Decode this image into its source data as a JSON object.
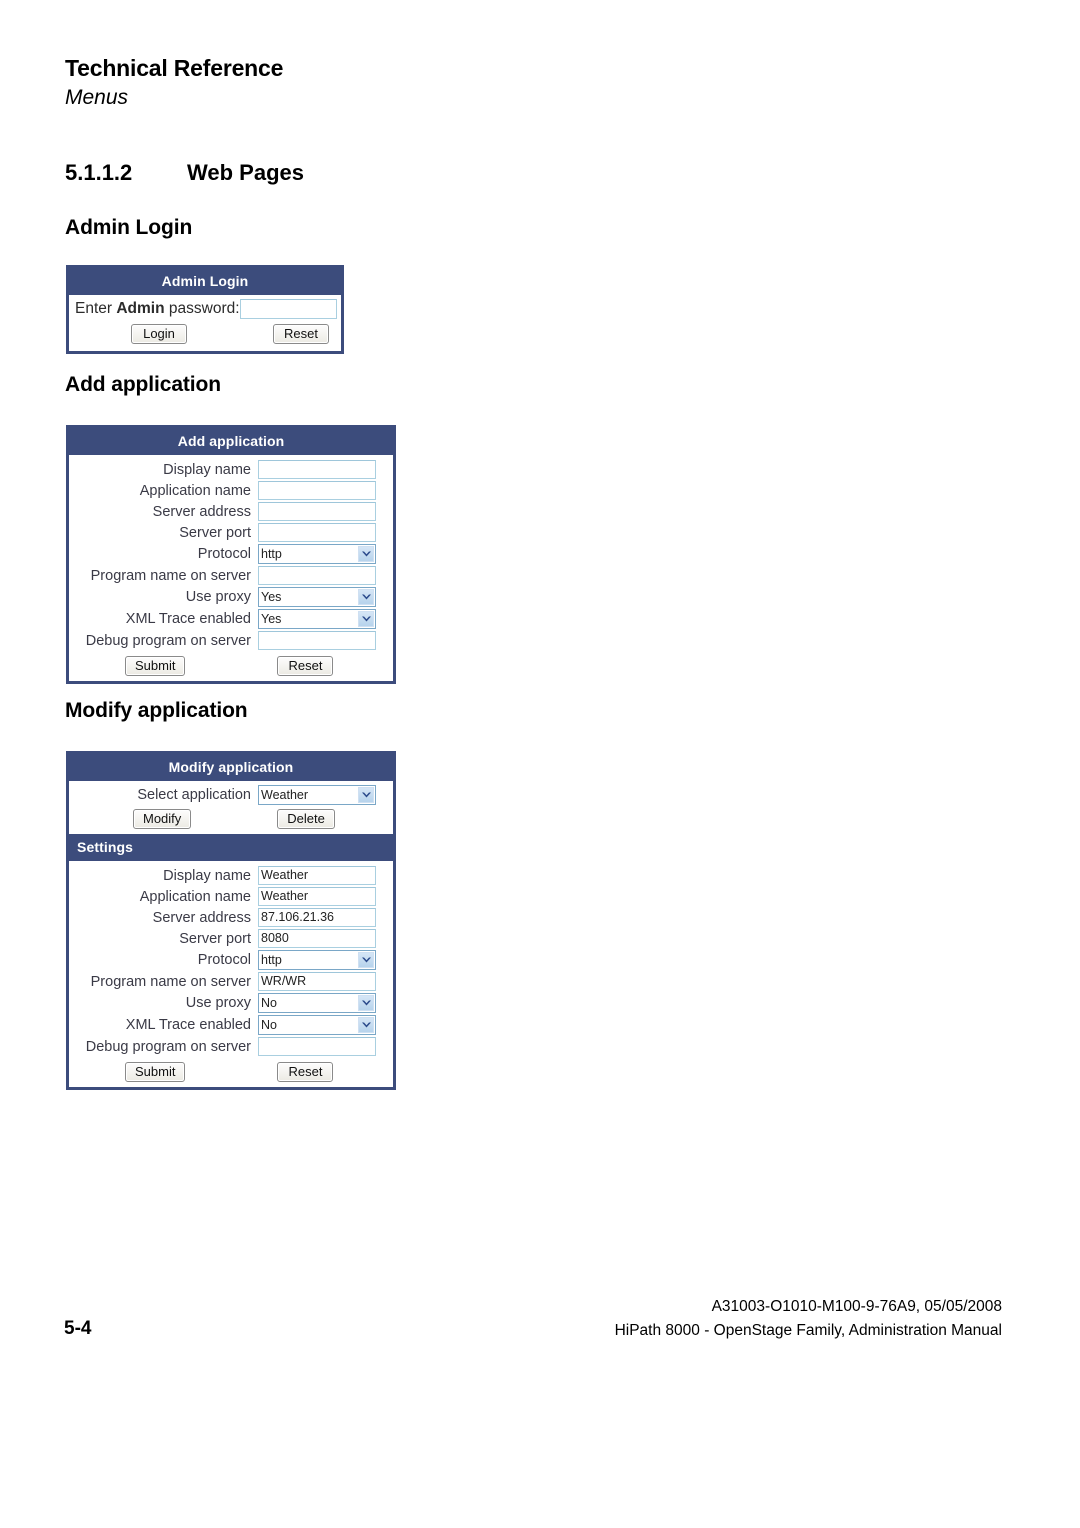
{
  "running_head": {
    "title": "Technical Reference",
    "subtitle": "Menus"
  },
  "section": {
    "number": "5.1.1.2",
    "title": "Web Pages"
  },
  "headings": {
    "admin_login": "Admin Login",
    "add_application": "Add application",
    "modify_application": "Modify application"
  },
  "admin_login_form": {
    "title": "Admin Login",
    "prompt_prefix": "Enter ",
    "prompt_bold": "Admin",
    "prompt_suffix": " password:",
    "password_value": "",
    "buttons": {
      "login": "Login",
      "reset": "Reset"
    }
  },
  "add_application_form": {
    "title": "Add application",
    "rows": [
      {
        "label": "Display name",
        "type": "text",
        "value": ""
      },
      {
        "label": "Application name",
        "type": "text",
        "value": ""
      },
      {
        "label": "Server address",
        "type": "text",
        "value": ""
      },
      {
        "label": "Server port",
        "type": "text",
        "value": ""
      },
      {
        "label": "Protocol",
        "type": "select",
        "value": "http"
      },
      {
        "label": "Program name on server",
        "type": "text",
        "value": ""
      },
      {
        "label": "Use proxy",
        "type": "select",
        "value": "Yes"
      },
      {
        "label": "XML Trace enabled",
        "type": "select",
        "value": "Yes"
      },
      {
        "label": "Debug program on server",
        "type": "text",
        "value": ""
      }
    ],
    "buttons": {
      "submit": "Submit",
      "reset": "Reset"
    }
  },
  "modify_application_form": {
    "title": "Modify application",
    "select_label": "Select application",
    "select_value": "Weather",
    "buttons_top": {
      "modify": "Modify",
      "delete": "Delete"
    },
    "settings_title": "Settings",
    "rows": [
      {
        "label": "Display name",
        "type": "text",
        "value": "Weather"
      },
      {
        "label": "Application name",
        "type": "text",
        "value": "Weather"
      },
      {
        "label": "Server address",
        "type": "text",
        "value": "87.106.21.36"
      },
      {
        "label": "Server port",
        "type": "text",
        "value": "8080"
      },
      {
        "label": "Protocol",
        "type": "select",
        "value": "http"
      },
      {
        "label": "Program name on server",
        "type": "text",
        "value": "WR/WR"
      },
      {
        "label": "Use proxy",
        "type": "select",
        "value": "No"
      },
      {
        "label": "XML Trace enabled",
        "type": "select",
        "value": "No"
      },
      {
        "label": "Debug program on server",
        "type": "text",
        "value": ""
      }
    ],
    "buttons": {
      "submit": "Submit",
      "reset": "Reset"
    }
  },
  "footer": {
    "page_number": "5-4",
    "doc_id": "A31003-O1010-M100-9-76A9, 05/05/2008",
    "doc_title": "HiPath 8000 - OpenStage Family, Administration Manual"
  },
  "colors": {
    "form_header_blue": "#3c4c7c",
    "input_border": "#a9cfe0",
    "select_arrow": "#2b4a8b"
  }
}
